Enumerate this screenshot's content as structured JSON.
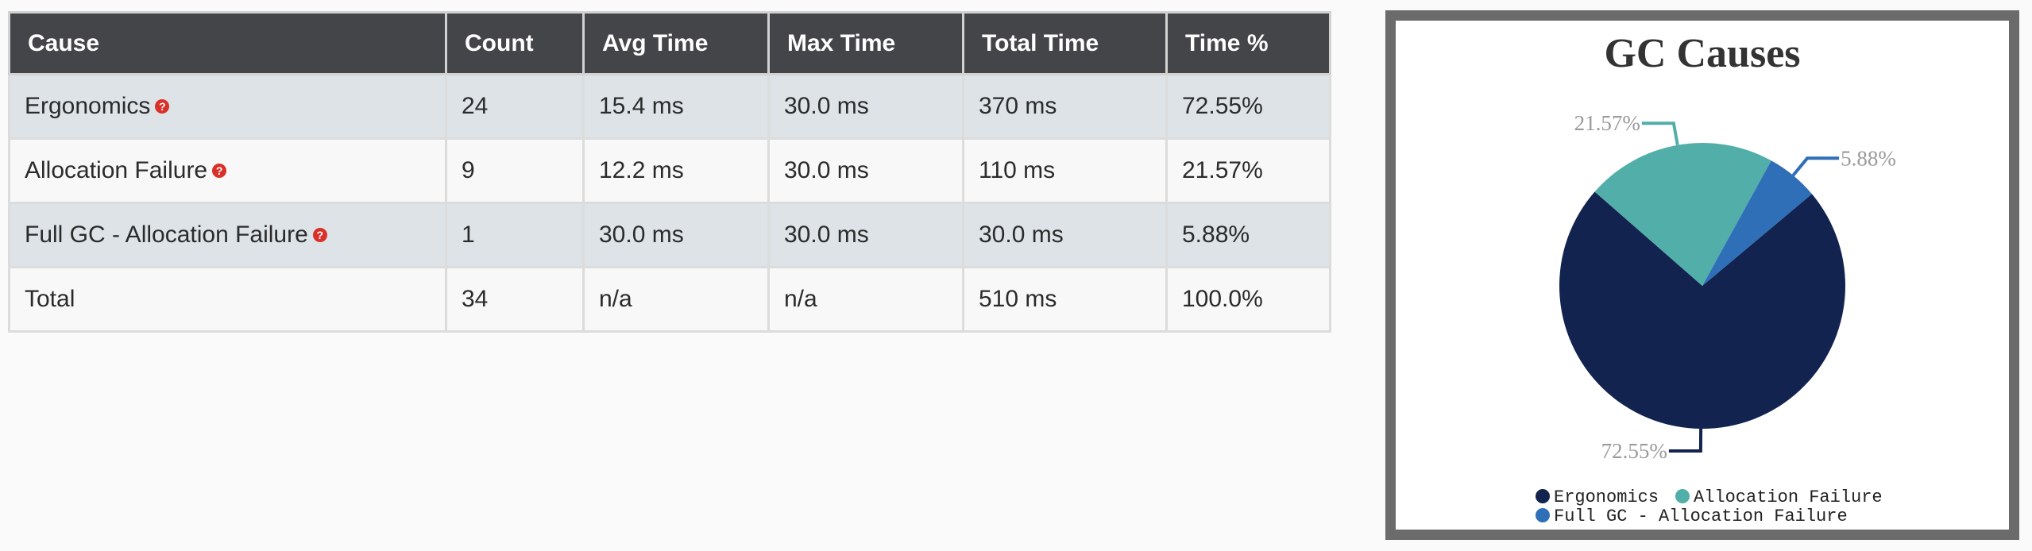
{
  "table": {
    "headers": [
      "Cause",
      "Count",
      "Avg Time",
      "Max Time",
      "Total Time",
      "Time %"
    ],
    "rows": [
      {
        "cause": "Ergonomics",
        "count": "24",
        "avg": "15.4 ms",
        "max": "30.0 ms",
        "total": "370 ms",
        "pct": "72.55%",
        "help": "?"
      },
      {
        "cause": "Allocation Failure",
        "count": "9",
        "avg": "12.2 ms",
        "max": "30.0 ms",
        "total": "110 ms",
        "pct": "21.57%",
        "help": "?"
      },
      {
        "cause": "Full GC - Allocation Failure",
        "count": "1",
        "avg": "30.0 ms",
        "max": "30.0 ms",
        "total": "30.0 ms",
        "pct": "5.88%",
        "help": "?"
      },
      {
        "cause": "Total",
        "count": "34",
        "avg": "n/a",
        "max": "n/a",
        "total": "510 ms",
        "pct": "100.0%"
      }
    ]
  },
  "chart_data": {
    "type": "pie",
    "title": "GC Causes",
    "categories": [
      "Ergonomics",
      "Allocation Failure",
      "Full GC - Allocation Failure"
    ],
    "values": [
      72.55,
      21.57,
      5.88
    ],
    "labels": [
      "72.55%",
      "21.57%",
      "5.88%"
    ],
    "colors": [
      "#13234f",
      "#52aea8",
      "#2e6fb8"
    ],
    "start_angle_deg": -40,
    "legend_position": "bottom"
  }
}
